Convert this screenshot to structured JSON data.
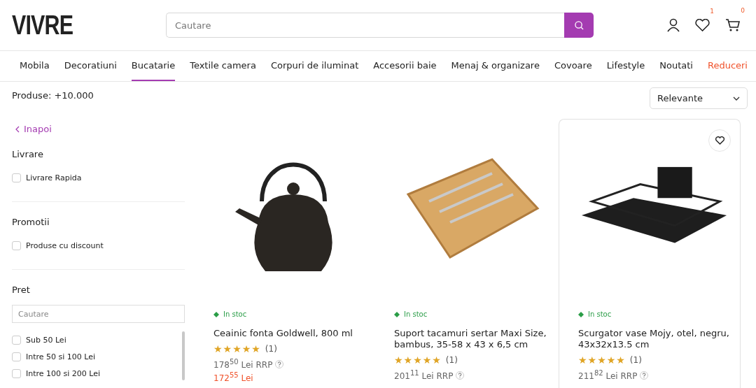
{
  "header": {
    "logo": "VIVRE",
    "search": {
      "placeholder": "Cautare"
    },
    "wishlist_count": "1",
    "cart_count": "0"
  },
  "nav": [
    {
      "label": "Mobila",
      "selected": false,
      "kind": "normal"
    },
    {
      "label": "Decoratiuni",
      "selected": false,
      "kind": "normal"
    },
    {
      "label": "Bucatarie",
      "selected": true,
      "kind": "normal"
    },
    {
      "label": "Textile camera",
      "selected": false,
      "kind": "normal"
    },
    {
      "label": "Corpuri de iluminat",
      "selected": false,
      "kind": "normal"
    },
    {
      "label": "Accesorii baie",
      "selected": false,
      "kind": "normal"
    },
    {
      "label": "Menaj & organizare",
      "selected": false,
      "kind": "normal"
    },
    {
      "label": "Covoare",
      "selected": false,
      "kind": "normal"
    },
    {
      "label": "Lifestyle",
      "selected": false,
      "kind": "normal"
    },
    {
      "label": "Noutati",
      "selected": false,
      "kind": "normal"
    },
    {
      "label": "Reduceri",
      "selected": false,
      "kind": "sale"
    }
  ],
  "product_count": "Produse: +10.000",
  "sort": {
    "value": "Relevante"
  },
  "sidebar": {
    "back": "Inapoi",
    "sections": [
      {
        "title": "Livrare",
        "options": [
          {
            "label": "Livrare Rapida",
            "checked": false
          }
        ]
      },
      {
        "title": "Promotii",
        "options": [
          {
            "label": "Produse cu discount",
            "checked": false
          }
        ]
      },
      {
        "title": "Pret",
        "search_placeholder": "Cautare",
        "options": [
          {
            "label": "Sub 50 Lei",
            "checked": false
          },
          {
            "label": "Intre 50 si 100 Lei",
            "checked": false
          },
          {
            "label": "Intre 100 si 200 Lei",
            "checked": false
          }
        ]
      }
    ]
  },
  "products": [
    {
      "kind": "teapot",
      "stock": "In stoc",
      "title": "Ceainic fonta Goldwell, 800 ml",
      "stars": 5,
      "reviews": "(1)",
      "rrp": "178$^{50}$ Lei RRP",
      "price": "172$^{55}$ Lei",
      "hovered": false
    },
    {
      "kind": "tray",
      "stock": "In stoc",
      "title": "Suport tacamuri sertar Maxi Size, bambus, 35-58 x 43 x 6,5 cm",
      "stars": 5,
      "reviews": "(1)",
      "rrp": "201$^{11}$ Lei RRP",
      "hovered": false
    },
    {
      "kind": "rack",
      "stock": "In stoc",
      "title": "Scurgator vase Mojy, otel, negru, 43x32x13.5 cm",
      "stars": 5,
      "reviews": "(1)",
      "rrp": "211$^{82}$ Lei RRP",
      "hovered": true
    }
  ]
}
